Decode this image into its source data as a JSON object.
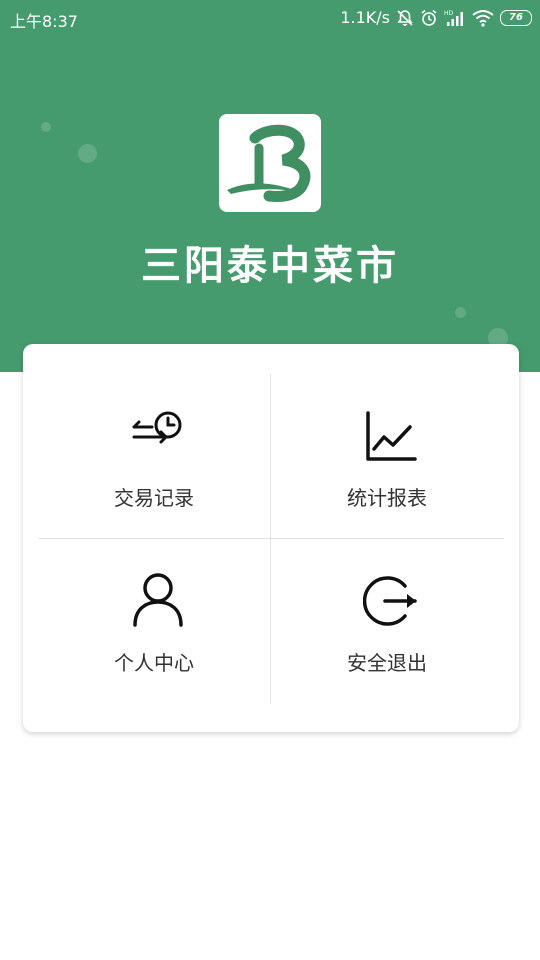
{
  "status_bar": {
    "time": "上午8:37",
    "network_speed": "1.1K/s",
    "battery": "76",
    "icons": [
      "mute-icon",
      "alarm-icon",
      "hd-signal-icon",
      "wifi-icon",
      "battery-icon"
    ]
  },
  "app": {
    "title": "三阳泰中菜市",
    "brand_color": "#459b6d",
    "logo_icon": "b-logo-icon"
  },
  "menu": {
    "items": [
      {
        "label": "交易记录",
        "icon": "transaction-history-icon"
      },
      {
        "label": "统计报表",
        "icon": "line-chart-icon"
      },
      {
        "label": "个人中心",
        "icon": "user-icon"
      },
      {
        "label": "安全退出",
        "icon": "logout-icon"
      }
    ]
  }
}
